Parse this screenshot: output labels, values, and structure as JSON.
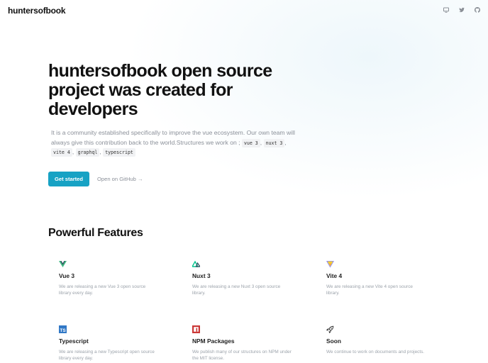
{
  "header": {
    "logo": "huntersofbook",
    "icons": [
      "monitor-icon",
      "twitter-icon",
      "github-icon"
    ]
  },
  "hero": {
    "title": "huntersofbook open source project was created for developers",
    "description": "It is a community established specifically to improve the vue ecosystem. Our own team will always give this contribution back to the world.Structures we work on ;",
    "tags": [
      "vue 3",
      "nuxt 3",
      "vite 4",
      "graphql",
      "typescript"
    ],
    "primary_button": "Get started",
    "secondary_link": "Open on GitHub →"
  },
  "features": {
    "title": "Powerful Features",
    "items": [
      {
        "icon": "vue-icon",
        "title": "Vue 3",
        "desc": "We are releasing a new Vue 3 open source library every day."
      },
      {
        "icon": "nuxt-icon",
        "title": "Nuxt 3",
        "desc": "We are releasing a new Nuxt 3 open source library."
      },
      {
        "icon": "vite-icon",
        "title": "Vite 4",
        "desc": "We are releasing a new Vite 4 open source library."
      },
      {
        "icon": "typescript-icon",
        "title": "Typescript",
        "desc": "We are releasing a new Typescript open source library every day."
      },
      {
        "icon": "npm-icon",
        "title": "NPM Packages",
        "desc": "We publish many of our structures on NPM under the MIT license."
      },
      {
        "icon": "rocket-icon",
        "title": "Soon",
        "desc": "We continue to work on documents and projects."
      }
    ]
  },
  "colors": {
    "primary": "#17a2c4",
    "text": "#111111",
    "muted": "#8b9099"
  }
}
